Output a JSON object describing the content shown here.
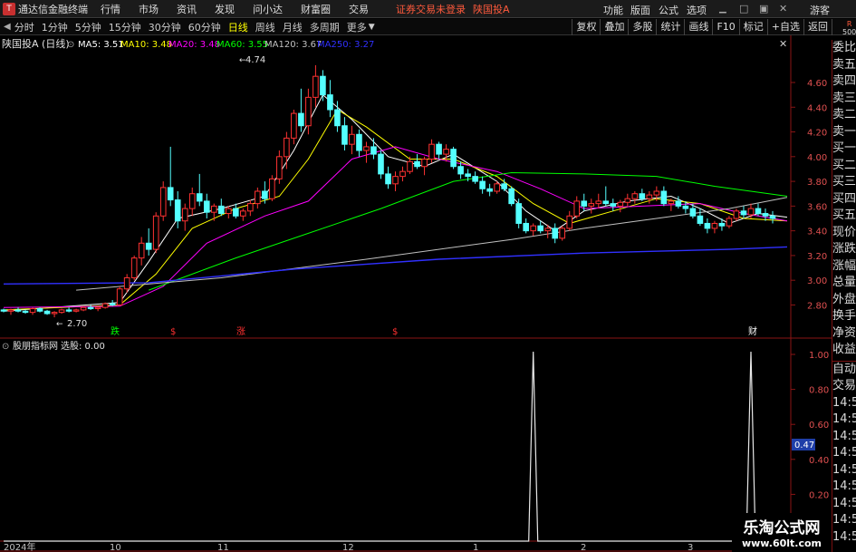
{
  "titlebar": {
    "app_name": "通达信金融终端",
    "menus": [
      "行情",
      "市场",
      "资讯",
      "发现",
      "问小达",
      "财富圈",
      "交易"
    ],
    "warning": "证券交易未登录",
    "stock": "陕国投A",
    "right_menus": [
      "功能",
      "版面",
      "公式",
      "选项"
    ],
    "right_extra": "游客"
  },
  "periodbar": {
    "items": [
      "分时",
      "1分钟",
      "5分钟",
      "15分钟",
      "30分钟",
      "60分钟",
      "日线",
      "周线",
      "月线",
      "多周期",
      "更多"
    ],
    "active": "日线",
    "tools": [
      "复权",
      "叠加",
      "多股",
      "统计",
      "画线",
      "F10",
      "标记",
      "+自选",
      "返回"
    ],
    "corner": [
      "R",
      "500"
    ]
  },
  "main_chart": {
    "title": "陕国投A (日线)",
    "ma_labels": [
      {
        "text": "MA5: 3.51",
        "color": "#ffffff"
      },
      {
        "text": "MA10: 3.48",
        "color": "#ffff00"
      },
      {
        "text": "MA20: 3.48",
        "color": "#ff00ff"
      },
      {
        "text": "MA60: 3.55",
        "color": "#00ff00"
      },
      {
        "text": "MA120: 3.67",
        "color": "#c0c0c0"
      },
      {
        "text": "MA250: 3.27",
        "color": "#3030ff"
      }
    ],
    "y_ticks": [
      "4.60",
      "4.40",
      "4.20",
      "4.00",
      "3.80",
      "3.60",
      "3.40",
      "3.20",
      "3.00",
      "2.80"
    ],
    "high_label": "4.74",
    "low_label": "2.70",
    "markers": [
      {
        "text": "跌",
        "color": "#00ff00"
      },
      {
        "text": "$",
        "color": "#ff3030"
      },
      {
        "text": "涨",
        "color": "#ff3030"
      },
      {
        "text": "$",
        "color": "#ff3030"
      },
      {
        "text": "财",
        "color": "#ffffff"
      }
    ]
  },
  "sub_chart": {
    "title": "股朋指标网",
    "field": "选股: 0.00",
    "y_ticks": [
      "1.00",
      "0.80",
      "0.60",
      "0.40",
      "0.20"
    ],
    "current": "0.47"
  },
  "x_axis": [
    "2024年",
    "10",
    "11",
    "12",
    "1",
    "2",
    "3"
  ],
  "right_panel": {
    "upper": [
      "委比",
      "卖五",
      "卖四",
      "卖三",
      "卖二",
      "卖一",
      "买一",
      "买二",
      "买三",
      "买四",
      "买五",
      "现价",
      "涨跌",
      "涨幅",
      "总量",
      "外盘",
      "换手",
      "净资",
      "收益"
    ],
    "lower": [
      "自动",
      "交易",
      "14:56",
      "14:56",
      "14:56",
      "14:56",
      "14:56",
      "14:56",
      "14:56",
      "14:56",
      "14:56"
    ]
  },
  "watermark": {
    "line1": "乐淘公式网",
    "line2": "www.60lt.com"
  },
  "colors": {
    "up": "#ff3232",
    "down": "#54ffff",
    "axis_red": "#8a1515",
    "ma5": "#ffffff",
    "ma10": "#ffff00",
    "ma20": "#ff00ff",
    "ma60": "#00ff00",
    "ma120": "#c0c0c0",
    "ma250": "#3030ff"
  },
  "chart_data": {
    "type": "candlestick",
    "y_range": [
      2.62,
      4.82
    ],
    "candles": [
      [
        2.76,
        2.77,
        2.74,
        2.75
      ],
      [
        2.75,
        2.77,
        2.72,
        2.76
      ],
      [
        2.76,
        2.78,
        2.74,
        2.75
      ],
      [
        2.75,
        2.76,
        2.73,
        2.74
      ],
      [
        2.74,
        2.78,
        2.72,
        2.77
      ],
      [
        2.77,
        2.78,
        2.74,
        2.75
      ],
      [
        2.75,
        2.76,
        2.72,
        2.73
      ],
      [
        2.73,
        2.75,
        2.7,
        2.74
      ],
      [
        2.74,
        2.77,
        2.73,
        2.76
      ],
      [
        2.76,
        2.78,
        2.74,
        2.75
      ],
      [
        2.75,
        2.77,
        2.74,
        2.76
      ],
      [
        2.76,
        2.79,
        2.75,
        2.78
      ],
      [
        2.78,
        2.8,
        2.76,
        2.77
      ],
      [
        2.77,
        2.79,
        2.75,
        2.78
      ],
      [
        2.78,
        2.82,
        2.77,
        2.81
      ],
      [
        2.81,
        2.84,
        2.79,
        2.8
      ],
      [
        2.8,
        2.95,
        2.79,
        2.93
      ],
      [
        2.93,
        3.05,
        2.9,
        3.02
      ],
      [
        3.02,
        3.2,
        3.0,
        3.18
      ],
      [
        3.18,
        3.35,
        3.12,
        3.3
      ],
      [
        3.3,
        3.42,
        3.2,
        3.25
      ],
      [
        3.25,
        3.55,
        3.22,
        3.52
      ],
      [
        3.52,
        3.8,
        3.48,
        3.75
      ],
      [
        3.75,
        4.08,
        3.6,
        3.65
      ],
      [
        3.65,
        3.72,
        3.42,
        3.48
      ],
      [
        3.48,
        3.62,
        3.4,
        3.58
      ],
      [
        3.58,
        3.75,
        3.52,
        3.7
      ],
      [
        3.7,
        3.86,
        3.6,
        3.64
      ],
      [
        3.64,
        3.7,
        3.5,
        3.55
      ],
      [
        3.55,
        3.62,
        3.48,
        3.6
      ],
      [
        3.6,
        3.66,
        3.52,
        3.54
      ],
      [
        3.54,
        3.6,
        3.5,
        3.58
      ],
      [
        3.58,
        3.62,
        3.5,
        3.52
      ],
      [
        3.52,
        3.58,
        3.48,
        3.56
      ],
      [
        3.56,
        3.65,
        3.52,
        3.62
      ],
      [
        3.62,
        3.75,
        3.58,
        3.72
      ],
      [
        3.72,
        3.8,
        3.62,
        3.66
      ],
      [
        3.66,
        3.85,
        3.64,
        3.82
      ],
      [
        3.82,
        4.05,
        3.78,
        4.0
      ],
      [
        4.0,
        4.2,
        3.9,
        4.15
      ],
      [
        4.15,
        4.38,
        4.1,
        4.35
      ],
      [
        4.35,
        4.55,
        4.2,
        4.25
      ],
      [
        4.25,
        4.55,
        4.18,
        4.48
      ],
      [
        4.48,
        4.74,
        4.4,
        4.65
      ],
      [
        4.65,
        4.7,
        4.45,
        4.5
      ],
      [
        4.5,
        4.62,
        4.32,
        4.38
      ],
      [
        4.38,
        4.45,
        4.2,
        4.25
      ],
      [
        4.25,
        4.32,
        4.05,
        4.1
      ],
      [
        4.1,
        4.25,
        4.02,
        4.18
      ],
      [
        4.18,
        4.22,
        4.0,
        4.05
      ],
      [
        4.05,
        4.12,
        3.95,
        4.08
      ],
      [
        4.08,
        4.15,
        3.98,
        4.02
      ],
      [
        4.02,
        4.05,
        3.82,
        3.86
      ],
      [
        3.86,
        3.92,
        3.74,
        3.78
      ],
      [
        3.78,
        3.88,
        3.72,
        3.84
      ],
      [
        3.84,
        3.92,
        3.8,
        3.88
      ],
      [
        3.88,
        4.0,
        3.86,
        3.96
      ],
      [
        3.96,
        4.02,
        3.9,
        3.92
      ],
      [
        3.92,
        4.0,
        3.85,
        3.98
      ],
      [
        3.98,
        4.14,
        3.95,
        4.1
      ],
      [
        4.1,
        4.12,
        3.98,
        4.02
      ],
      [
        4.02,
        4.1,
        3.96,
        4.06
      ],
      [
        4.06,
        4.08,
        3.9,
        3.92
      ],
      [
        3.92,
        3.96,
        3.82,
        3.86
      ],
      [
        3.86,
        3.9,
        3.8,
        3.84
      ],
      [
        3.84,
        3.88,
        3.78,
        3.8
      ],
      [
        3.8,
        3.84,
        3.7,
        3.74
      ],
      [
        3.74,
        3.78,
        3.68,
        3.72
      ],
      [
        3.72,
        3.8,
        3.7,
        3.78
      ],
      [
        3.78,
        3.82,
        3.72,
        3.74
      ],
      [
        3.74,
        3.76,
        3.6,
        3.62
      ],
      [
        3.62,
        3.66,
        3.42,
        3.46
      ],
      [
        3.46,
        3.5,
        3.38,
        3.4
      ],
      [
        3.4,
        3.46,
        3.36,
        3.44
      ],
      [
        3.44,
        3.48,
        3.38,
        3.4
      ],
      [
        3.4,
        3.45,
        3.34,
        3.42
      ],
      [
        3.42,
        3.46,
        3.3,
        3.34
      ],
      [
        3.34,
        3.44,
        3.32,
        3.42
      ],
      [
        3.42,
        3.56,
        3.4,
        3.52
      ],
      [
        3.52,
        3.68,
        3.5,
        3.64
      ],
      [
        3.64,
        3.7,
        3.56,
        3.6
      ],
      [
        3.6,
        3.66,
        3.54,
        3.62
      ],
      [
        3.62,
        3.7,
        3.58,
        3.64
      ],
      [
        3.64,
        3.76,
        3.6,
        3.62
      ],
      [
        3.62,
        3.66,
        3.56,
        3.6
      ],
      [
        3.6,
        3.65,
        3.55,
        3.63
      ],
      [
        3.63,
        3.7,
        3.6,
        3.66
      ],
      [
        3.66,
        3.72,
        3.62,
        3.7
      ],
      [
        3.7,
        3.74,
        3.64,
        3.66
      ],
      [
        3.66,
        3.72,
        3.62,
        3.69
      ],
      [
        3.69,
        3.76,
        3.64,
        3.72
      ],
      [
        3.72,
        3.76,
        3.6,
        3.62
      ],
      [
        3.62,
        3.66,
        3.56,
        3.64
      ],
      [
        3.64,
        3.68,
        3.58,
        3.6
      ],
      [
        3.6,
        3.64,
        3.54,
        3.58
      ],
      [
        3.58,
        3.62,
        3.5,
        3.52
      ],
      [
        3.52,
        3.58,
        3.44,
        3.46
      ],
      [
        3.46,
        3.5,
        3.38,
        3.42
      ],
      [
        3.42,
        3.48,
        3.38,
        3.46
      ],
      [
        3.46,
        3.5,
        3.4,
        3.44
      ],
      [
        3.44,
        3.52,
        3.42,
        3.5
      ],
      [
        3.5,
        3.58,
        3.48,
        3.56
      ],
      [
        3.56,
        3.6,
        3.5,
        3.53
      ],
      [
        3.53,
        3.62,
        3.5,
        3.58
      ],
      [
        3.58,
        3.62,
        3.52,
        3.54
      ],
      [
        3.54,
        3.58,
        3.48,
        3.52
      ],
      [
        3.52,
        3.56,
        3.46,
        3.5
      ]
    ],
    "ma_series": {
      "MA5": [
        [
          0,
          2.75
        ],
        [
          16,
          2.82
        ],
        [
          20,
          3.15
        ],
        [
          24,
          3.5
        ],
        [
          30,
          3.58
        ],
        [
          36,
          3.68
        ],
        [
          40,
          4.05
        ],
        [
          44,
          4.5
        ],
        [
          48,
          4.3
        ],
        [
          53,
          4.0
        ],
        [
          58,
          3.92
        ],
        [
          62,
          4.02
        ],
        [
          68,
          3.8
        ],
        [
          72,
          3.56
        ],
        [
          76,
          3.4
        ],
        [
          80,
          3.56
        ],
        [
          86,
          3.64
        ],
        [
          92,
          3.68
        ],
        [
          96,
          3.58
        ],
        [
          100,
          3.46
        ],
        [
          104,
          3.54
        ],
        [
          108,
          3.51
        ]
      ],
      "MA10": [
        [
          0,
          2.76
        ],
        [
          16,
          2.8
        ],
        [
          21,
          3.05
        ],
        [
          26,
          3.42
        ],
        [
          32,
          3.58
        ],
        [
          38,
          3.68
        ],
        [
          42,
          3.98
        ],
        [
          46,
          4.38
        ],
        [
          50,
          4.24
        ],
        [
          56,
          3.98
        ],
        [
          62,
          3.98
        ],
        [
          68,
          3.84
        ],
        [
          73,
          3.62
        ],
        [
          78,
          3.46
        ],
        [
          84,
          3.56
        ],
        [
          90,
          3.66
        ],
        [
          96,
          3.62
        ],
        [
          102,
          3.5
        ],
        [
          108,
          3.48
        ]
      ],
      "MA20": [
        [
          0,
          2.78
        ],
        [
          16,
          2.79
        ],
        [
          22,
          2.95
        ],
        [
          28,
          3.3
        ],
        [
          36,
          3.52
        ],
        [
          42,
          3.64
        ],
        [
          48,
          3.98
        ],
        [
          54,
          4.08
        ],
        [
          60,
          3.98
        ],
        [
          68,
          3.88
        ],
        [
          74,
          3.74
        ],
        [
          80,
          3.58
        ],
        [
          88,
          3.6
        ],
        [
          96,
          3.62
        ],
        [
          102,
          3.54
        ],
        [
          108,
          3.48
        ]
      ],
      "MA60": [
        [
          20,
          2.92
        ],
        [
          32,
          3.18
        ],
        [
          42,
          3.38
        ],
        [
          52,
          3.58
        ],
        [
          62,
          3.8
        ],
        [
          70,
          3.87
        ],
        [
          80,
          3.86
        ],
        [
          90,
          3.84
        ],
        [
          98,
          3.76
        ],
        [
          108,
          3.68
        ]
      ],
      "MA120": [
        [
          10,
          2.92
        ],
        [
          30,
          3.02
        ],
        [
          50,
          3.17
        ],
        [
          70,
          3.33
        ],
        [
          80,
          3.42
        ],
        [
          90,
          3.5
        ],
        [
          100,
          3.58
        ],
        [
          108,
          3.67
        ]
      ],
      "MA250": [
        [
          0,
          2.97
        ],
        [
          20,
          2.98
        ],
        [
          40,
          3.09
        ],
        [
          60,
          3.17
        ],
        [
          80,
          3.22
        ],
        [
          100,
          3.25
        ],
        [
          108,
          3.27
        ]
      ]
    },
    "signal": {
      "peaks_at": [
        73,
        103
      ],
      "values": [
        0.0,
        1.0
      ]
    }
  }
}
